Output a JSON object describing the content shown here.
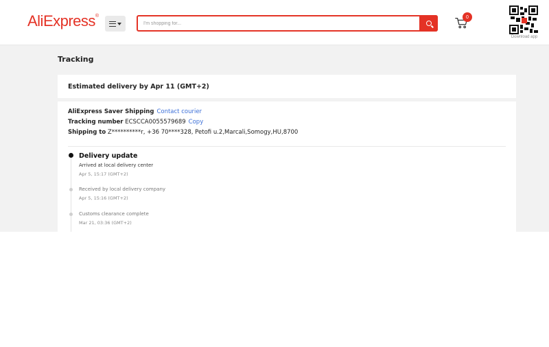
{
  "header": {
    "logo": "AliExpress",
    "logo_mark": "®",
    "search_placeholder": "I'm shopping for...",
    "cart_count": "0",
    "qr_caption": "Download app"
  },
  "page": {
    "title": "Tracking",
    "estimated_delivery": "Estimated delivery by Apr 11 (GMT+2)"
  },
  "shipment": {
    "carrier_label": "AliExpress Saver Shipping",
    "contact_link": "Contact courier",
    "tracking_label": "Tracking number",
    "tracking_number": "ECSCCA0055579689",
    "copy_link": "Copy",
    "shipping_to_label": "Shipping to",
    "shipping_to_value": "Z**********r, +36 70****328, Petofi u.2,Marcali,Somogy,HU,8700"
  },
  "timeline": [
    {
      "title": "Delivery update",
      "description": "Arrived at local delivery center",
      "time": "Apr 5, 15:17 (GMT+2)"
    },
    {
      "title": "",
      "description": "Received by local delivery company",
      "time": "Apr 5, 15:16 (GMT+2)"
    },
    {
      "title": "",
      "description": "Customs clearance complete",
      "time": "Mar 21, 03:36 (GMT+2)"
    }
  ],
  "colors": {
    "brand": "#e43225",
    "link": "#3b6fd8",
    "background": "#f2f2f2"
  }
}
